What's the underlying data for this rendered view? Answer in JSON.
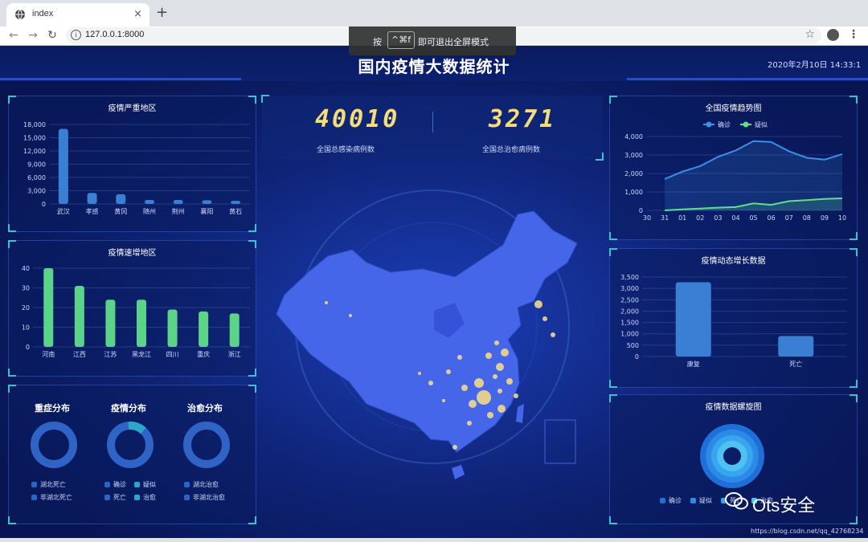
{
  "browser": {
    "tab_title": "index",
    "tab_close": "×",
    "new_tab": "+",
    "url": "127.0.0.1:8000",
    "back": "←",
    "forward": "→",
    "reload": "↻",
    "star": "☆",
    "menu": "⋮",
    "fullscreen_toast": {
      "prefix": "按",
      "key": "^⌘f",
      "suffix": "即可退出全屏模式"
    }
  },
  "dashboard": {
    "title": "国内疫情大数据统计",
    "time": "2020年2月10日 14:33:1",
    "counters": [
      {
        "value": "40010",
        "label": "全国总感染病例数"
      },
      {
        "value": "3271",
        "label": "全国总治愈病例数"
      }
    ],
    "pies": [
      {
        "title": "重症分布",
        "legend": [
          "湖北死亡",
          "非湖北死亡"
        ]
      },
      {
        "title": "疫情分布",
        "legend": [
          "确诊",
          "疑似",
          "死亡",
          "治愈"
        ]
      },
      {
        "title": "治愈分布",
        "legend": [
          "湖北治愈",
          "非湖北治愈"
        ]
      }
    ],
    "spiral_legend": [
      "确诊",
      "疑似",
      "死亡",
      "治愈"
    ],
    "watermark": "Ots安全",
    "credit": "https://blog.csdn.net/qq_42768234",
    "colors": {
      "bar_blue": "#3a7fd4",
      "bar_green": "#5bd48a",
      "line_blue": "#3d8ee6",
      "line_green": "#5fe08a",
      "counter_yellow": "#f7dd7a",
      "accent": "#35c3d6"
    }
  },
  "chart_data": [
    {
      "type": "bar",
      "title": "疫情严重地区",
      "categories": [
        "武汉",
        "孝感",
        "黄冈",
        "随州",
        "荆州",
        "襄阳",
        "黄石"
      ],
      "values": [
        17000,
        2500,
        2200,
        900,
        900,
        850,
        700
      ],
      "yticks": [
        "0",
        "3,000",
        "6,000",
        "9,000",
        "12,000",
        "15,000",
        "18,000"
      ],
      "ylim": [
        0,
        18000
      ]
    },
    {
      "type": "bar",
      "title": "疫情速增地区",
      "categories": [
        "河南",
        "江西",
        "江苏",
        "黑龙江",
        "四川",
        "重庆",
        "浙江"
      ],
      "values": [
        40,
        31,
        24,
        24,
        19,
        18,
        17
      ],
      "yticks": [
        "0",
        "10",
        "20",
        "30",
        "40"
      ],
      "ylim": [
        0,
        40
      ]
    },
    {
      "type": "line",
      "title": "全国疫情趋势图",
      "x": [
        "30",
        "31",
        "01",
        "02",
        "03",
        "04",
        "05",
        "06",
        "07",
        "08",
        "09",
        "10"
      ],
      "series": [
        {
          "name": "确诊",
          "values": [
            null,
            1700,
            2100,
            2400,
            2900,
            3250,
            3750,
            3700,
            3200,
            2850,
            2750,
            3050
          ]
        },
        {
          "name": "疑似",
          "values": [
            null,
            0,
            50,
            100,
            150,
            180,
            380,
            300,
            500,
            550,
            620,
            650
          ]
        }
      ],
      "yticks": [
        "0",
        "1,000",
        "2,000",
        "3,000",
        "4,000"
      ],
      "ylim": [
        0,
        4000
      ]
    },
    {
      "type": "bar",
      "title": "疫情动态增长数据",
      "categories": [
        "康复",
        "死亡"
      ],
      "values": [
        3271,
        900
      ],
      "yticks": [
        "0",
        "500",
        "1,000",
        "1,500",
        "2,000",
        "2,500",
        "3,000",
        "3,500"
      ],
      "ylim": [
        0,
        3500
      ]
    },
    {
      "type": "pie",
      "title": "疫情数据螺旋图",
      "series": [
        "确诊",
        "疑似",
        "死亡",
        "治愈"
      ]
    }
  ]
}
